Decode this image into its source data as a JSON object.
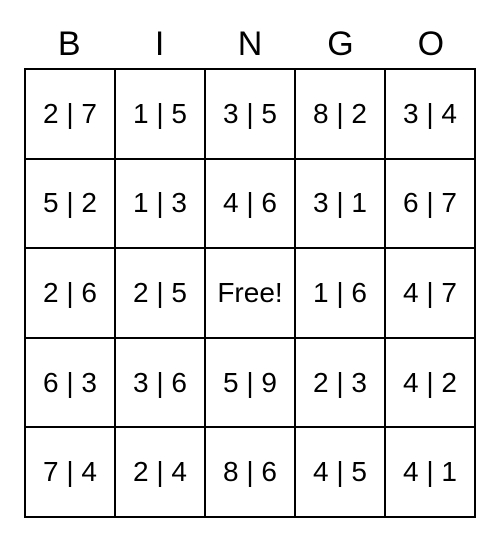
{
  "headers": [
    "B",
    "I",
    "N",
    "G",
    "O"
  ],
  "grid": [
    [
      "2 | 7",
      "1 | 5",
      "3 | 5",
      "8 | 2",
      "3 | 4"
    ],
    [
      "5 | 2",
      "1 | 3",
      "4 | 6",
      "3 | 1",
      "6 | 7"
    ],
    [
      "2 | 6",
      "2 | 5",
      "Free!",
      "1 | 6",
      "4 | 7"
    ],
    [
      "6 | 3",
      "3 | 6",
      "5 | 9",
      "2 | 3",
      "4 | 2"
    ],
    [
      "7 | 4",
      "2 | 4",
      "8 | 6",
      "4 | 5",
      "4 | 1"
    ]
  ]
}
